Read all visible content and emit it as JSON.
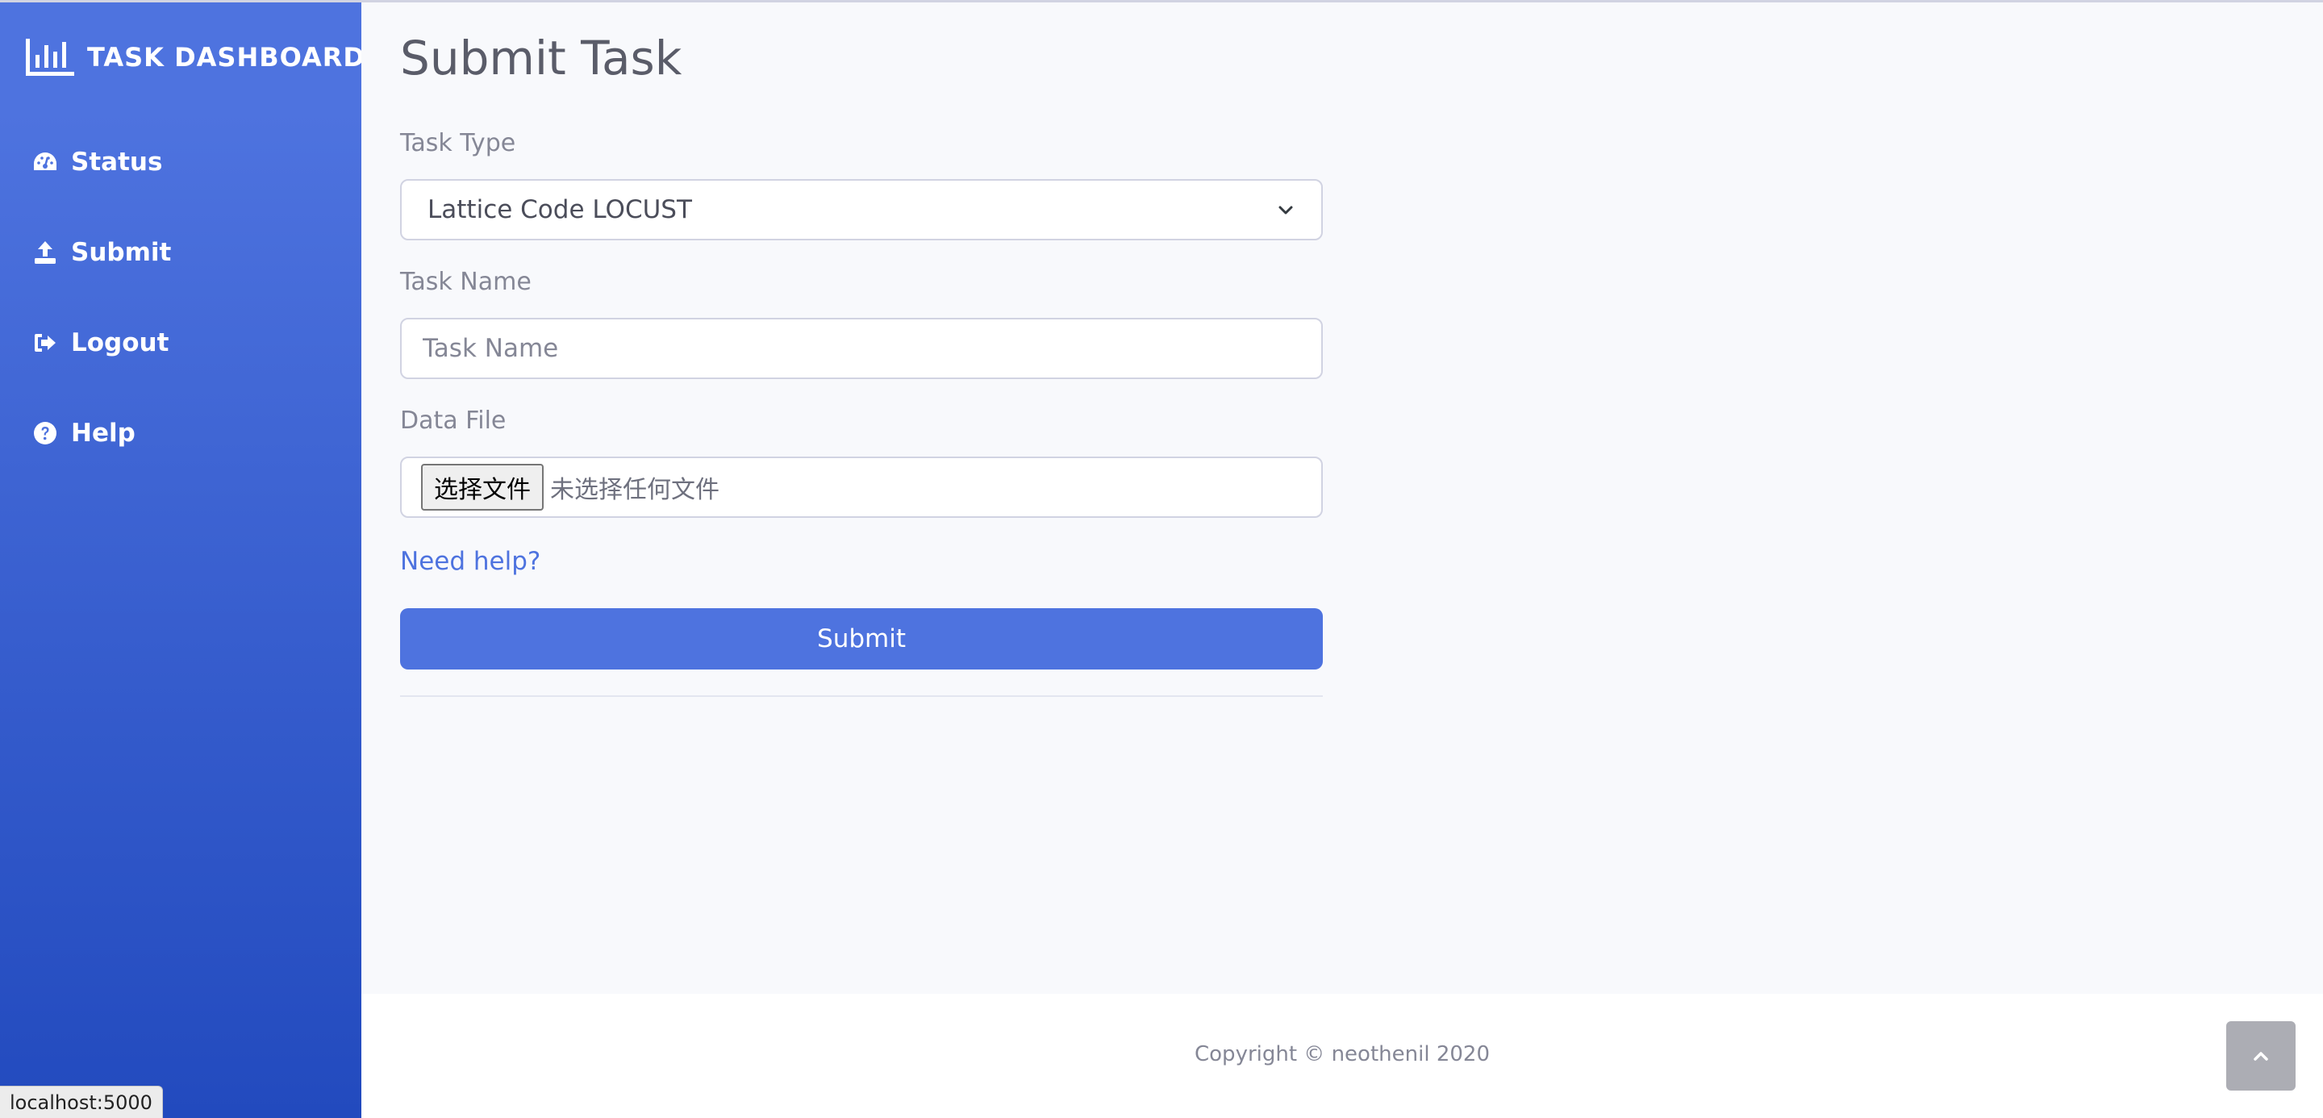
{
  "sidebar": {
    "brand": "Task Dashboard",
    "items": [
      {
        "label": "Status",
        "icon": "tachometer-icon"
      },
      {
        "label": "Submit",
        "icon": "upload-icon"
      },
      {
        "label": "Logout",
        "icon": "sign-out-icon"
      },
      {
        "label": "Help",
        "icon": "question-circle-icon"
      }
    ]
  },
  "main": {
    "title": "Submit Task",
    "task_type": {
      "label": "Task Type",
      "selected": "Lattice Code LOCUST"
    },
    "task_name": {
      "label": "Task Name",
      "placeholder": "Task Name"
    },
    "data_file": {
      "label": "Data File",
      "button": "选择文件",
      "status": "未选择任何文件"
    },
    "help_link": "Need help?",
    "submit_label": "Submit"
  },
  "footer": {
    "copyright": "Copyright © neothenil 2020"
  },
  "statusbar": {
    "url": "localhost:5000"
  },
  "colors": {
    "primary": "#4e73df",
    "sidebar_gradient_end": "#224abe",
    "background": "#f8f9fc",
    "text_muted": "#858796"
  }
}
